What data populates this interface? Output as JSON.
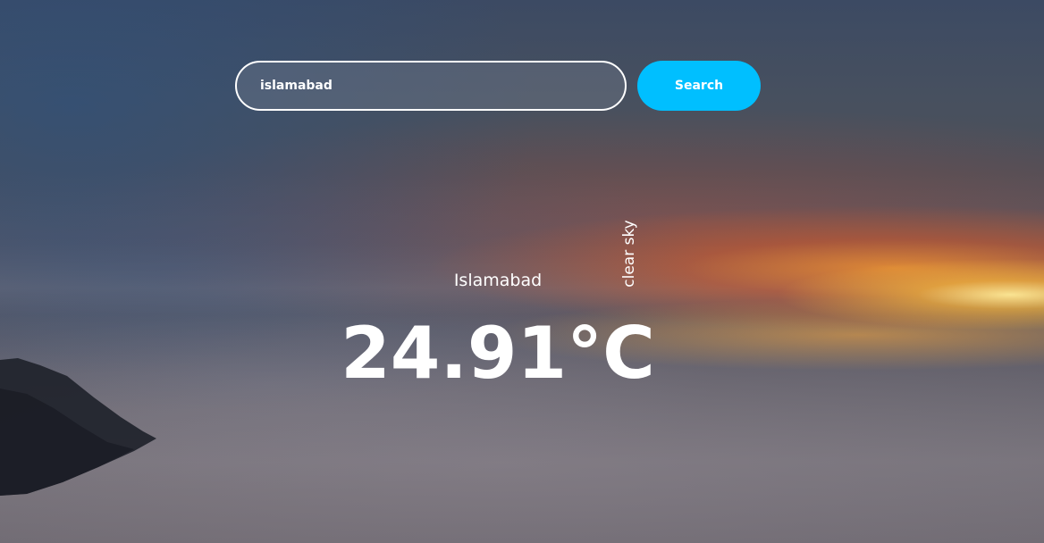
{
  "search": {
    "value": "islamabad",
    "button_label": "Search"
  },
  "weather": {
    "city": "Islamabad",
    "condition": "clear sky",
    "temperature": "24.91°C"
  },
  "colors": {
    "search_button": "#00bfff",
    "text": "#ffffff"
  }
}
